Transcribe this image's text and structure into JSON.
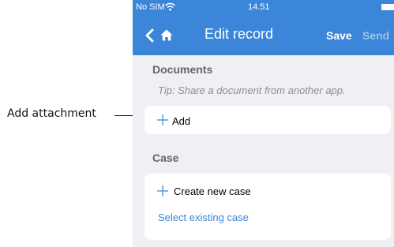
{
  "callout": {
    "label": "Add attachment"
  },
  "statusbar": {
    "carrier": "No SIM",
    "time": "14.51"
  },
  "navbar": {
    "title": "Edit record",
    "save_label": "Save",
    "send_label": "Send"
  },
  "documents": {
    "title": "Documents",
    "tip": "Tip: Share a document from another app.",
    "add_label": "Add"
  },
  "case": {
    "title": "Case",
    "create_label": "Create new case",
    "select_label": "Select existing case"
  },
  "colors": {
    "accent": "#3b86d8",
    "background": "#efeff4",
    "send_disabled": "#9fc2ea",
    "section_title": "#666666"
  },
  "icons": [
    "wifi-icon",
    "battery-icon",
    "back-icon",
    "home-icon",
    "plus-icon"
  ]
}
